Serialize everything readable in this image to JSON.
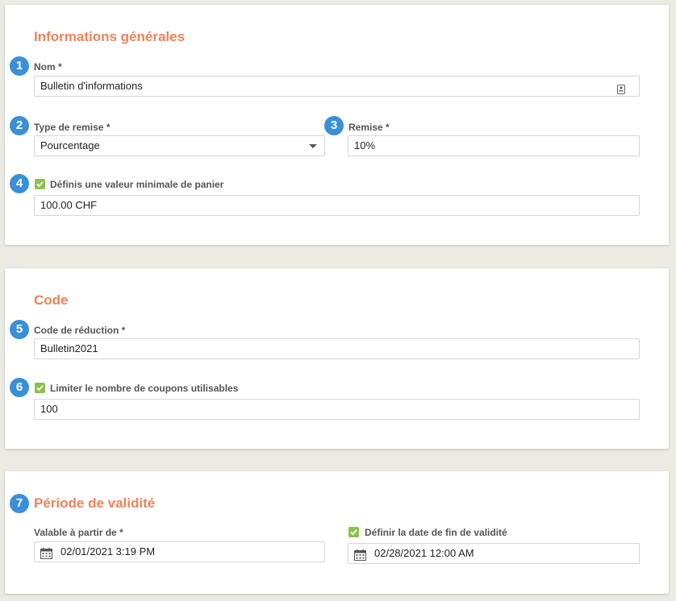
{
  "sections": {
    "general": {
      "title": "Informations générales",
      "name_label": "Nom *",
      "name_value": "Bulletin d'informations",
      "discount_type_label": "Type de remise *",
      "discount_type_value": "Pourcentage",
      "discount_label": "Remise *",
      "discount_value": "10%",
      "min_cart_label": "Définis une valeur minimale de panier",
      "min_cart_checked": true,
      "min_cart_value": "100.00 CHF"
    },
    "code": {
      "title": "Code",
      "code_label": "Code de réduction *",
      "code_value": "Bulletin2021",
      "limit_label": "Limiter le nombre de coupons utilisables",
      "limit_checked": true,
      "limit_value": "100"
    },
    "validity": {
      "title": "Période de validité",
      "start_label": "Valable à partir de *",
      "start_value": "02/01/2021 3:19 PM",
      "end_label": "Définir la date de fin de validité",
      "end_checked": true,
      "end_value": "02/28/2021 12:00 AM"
    }
  },
  "badges": [
    "1",
    "2",
    "3",
    "4",
    "5",
    "6",
    "7"
  ],
  "colors": {
    "accent": "#ef8259",
    "badge": "#3a8fd9",
    "checkbox": "#8dc04e",
    "background": "#ebebe3"
  },
  "icons": {
    "name_field": "contact-card-icon",
    "dropdown": "chevron-down-icon",
    "checkbox": "checkmark-icon",
    "date_field": "calendar-icon"
  }
}
